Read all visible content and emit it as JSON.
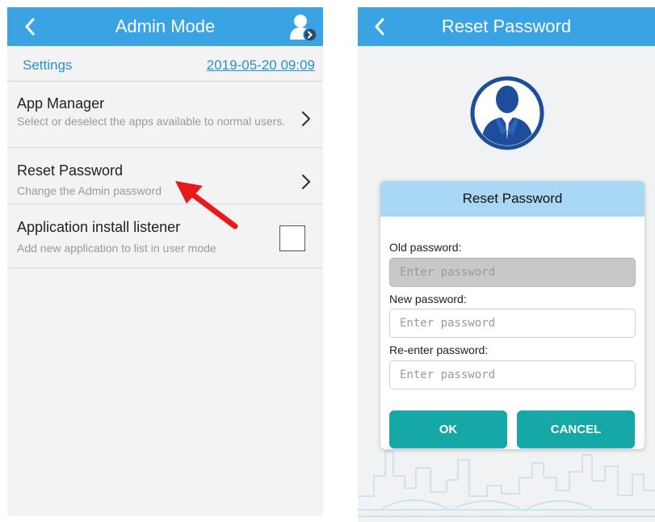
{
  "left": {
    "header": {
      "title": "Admin Mode"
    },
    "subheader": {
      "settings_label": "Settings",
      "datetime": "2019-05-20 09:09"
    },
    "items": [
      {
        "title": "App Manager",
        "description": "Select or deselect the apps available to normal users."
      },
      {
        "title": "Reset Password",
        "description": "Change the Admin password"
      },
      {
        "title": "Application install listener",
        "description": "Add new application to list in user mode",
        "checked": false
      }
    ]
  },
  "right": {
    "header": {
      "title": "Reset Password"
    },
    "dialog": {
      "title": "Reset Password",
      "old_label": "Old password:",
      "old_placeholder": "Enter password",
      "new_label": "New password:",
      "new_placeholder": "Enter password",
      "reenter_label": "Re-enter password:",
      "reenter_placeholder": "Enter password",
      "ok_label": "OK",
      "cancel_label": "CANCEL"
    }
  },
  "colors": {
    "header_blue": "#3aa3e3",
    "link_blue": "#2a8fd0",
    "dialog_header": "#a9d8f5",
    "button_teal": "#16a8a6",
    "arrow_red": "#e8191b"
  },
  "icons": {
    "back": "chevron-left-icon",
    "user_settings": "user-gear-icon",
    "chevron": "chevron-right-icon",
    "avatar": "businessman-avatar-icon"
  }
}
